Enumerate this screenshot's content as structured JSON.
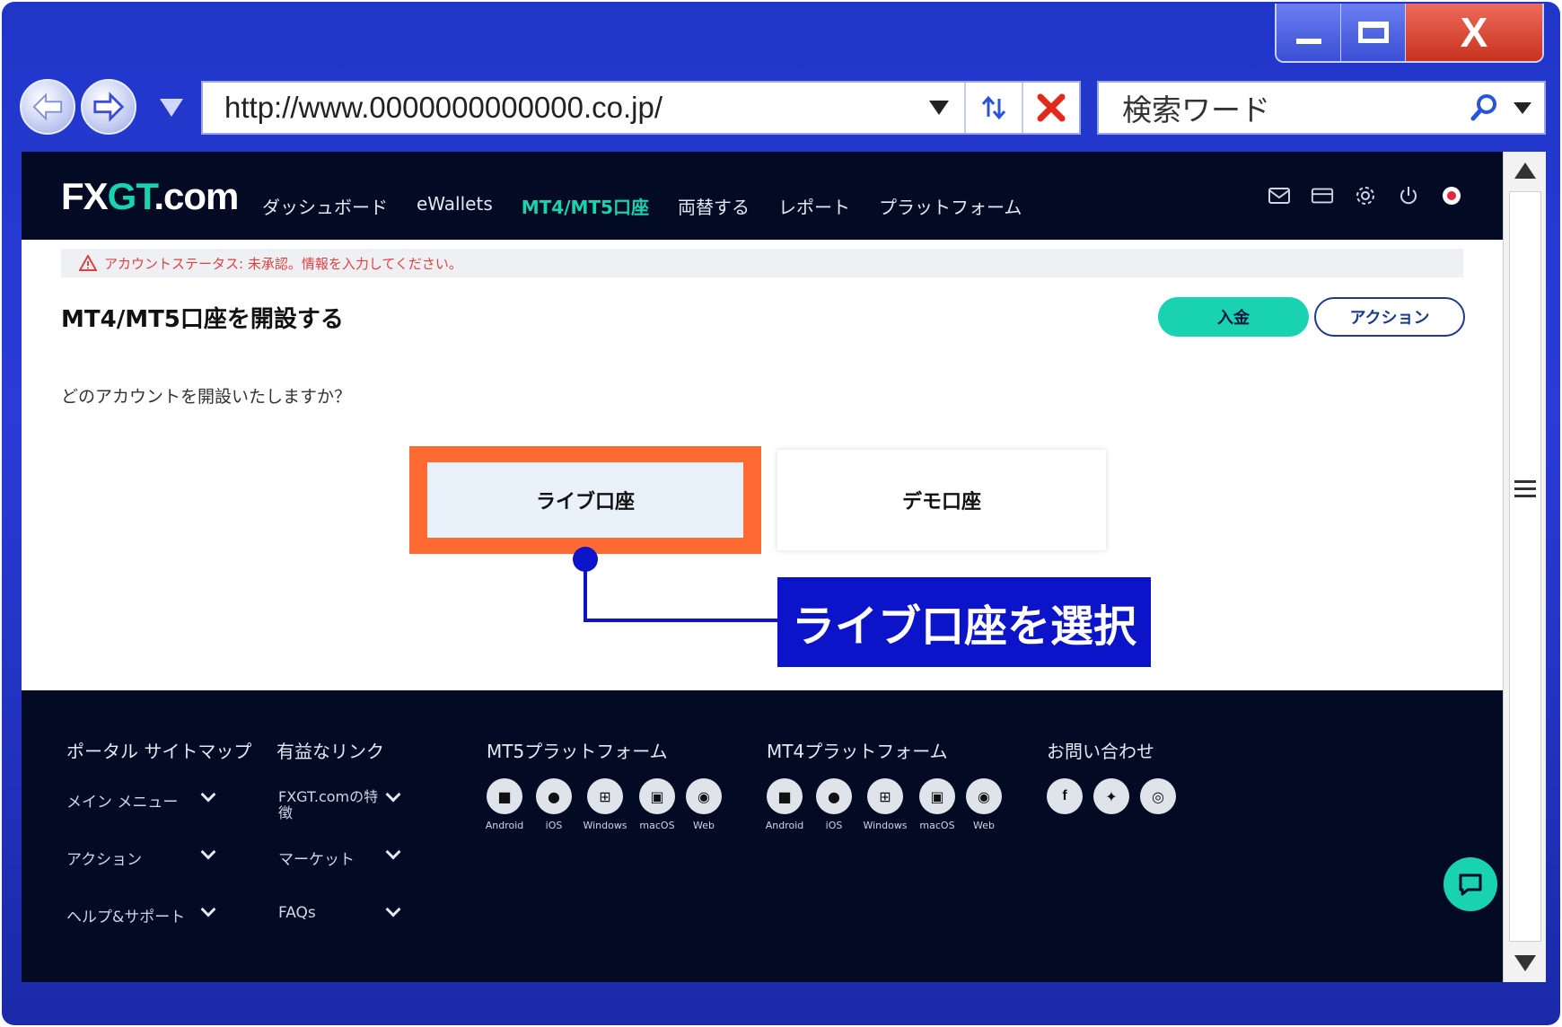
{
  "browser": {
    "url": "http://www.0000000000000.co.jp/",
    "search_placeholder": "検索ワード",
    "close_glyph": "X"
  },
  "site": {
    "logo_prefix": "FX",
    "logo_gt": "GT",
    "logo_suffix": ".com",
    "menu": [
      "ダッシュボード",
      "eWallets",
      "MT4/MT5口座",
      "両替する",
      "レポート",
      "プラットフォーム"
    ],
    "active_menu_index": 2,
    "alert": "アカウントステータス: 未承認。情報を入力してください。",
    "page_title": "MT4/MT5口座を開設する",
    "deposit_label": "入金",
    "action_label": "アクション",
    "question": "どのアカウントを開設いたしますか？",
    "live_account": "ライブ口座",
    "demo_account": "デモ口座",
    "callout": "ライブ口座を選択"
  },
  "footer": {
    "col1_title": "ポータル サイトマップ",
    "col1_links": [
      "メイン メニュー",
      "アクション",
      "ヘルプ&サポート"
    ],
    "col2_title": "有益なリンク",
    "col2_links": [
      "FXGT.comの特徴",
      "マーケット",
      "FAQs"
    ],
    "mt5_title": "MT5プラットフォーム",
    "mt4_title": "MT4プラットフォーム",
    "platforms": [
      "Android",
      "iOS",
      "Windows",
      "macOS",
      "Web"
    ],
    "contact_title": "お問い合わせ",
    "social": [
      "facebook-icon",
      "twitter-icon",
      "instagram-icon"
    ]
  },
  "colors": {
    "accent": "#19d3b0",
    "nav_bg": "#020a24",
    "highlight": "#ff6a33",
    "callout": "#0b14c8"
  }
}
